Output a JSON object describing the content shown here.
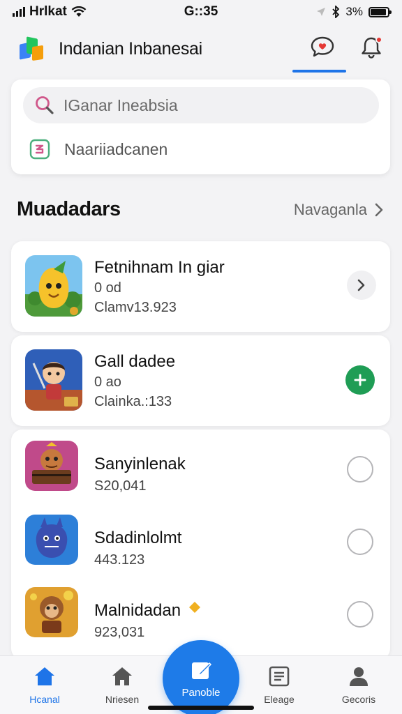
{
  "status_bar": {
    "carrier": "Hrlkat",
    "time": "G::35",
    "battery_text": "3%",
    "battery_level": 0.9
  },
  "header": {
    "app_title": "Indanian Inbanesai",
    "icons": [
      "app-logo-icon",
      "chat-icon",
      "bell-icon"
    ],
    "accent_color": "#1e74e8",
    "notification_color": "#e53935"
  },
  "search": {
    "placeholder": "IGanar Ineabsia",
    "filter_label": "Naariiadcanen"
  },
  "section": {
    "title": "Muadadars",
    "link_label": "Navaganla"
  },
  "games": [
    {
      "title": "Fetnihnam In giar",
      "line1": "0 od",
      "line2": "Clamv13.923",
      "action": "chevron",
      "thumb": "mango-character-icon"
    },
    {
      "title": "Gall dadee",
      "line1": "0 ao",
      "line2": "Clainka.:133",
      "action": "add",
      "thumb": "warrior-boy-icon"
    },
    {
      "title": "Sanyinlenak",
      "line1": "S20,041",
      "action": "select",
      "thumb": "chest-monster-icon"
    },
    {
      "title": "Sdadinlolmt",
      "line1": "443.123",
      "action": "select",
      "thumb": "blue-creature-icon"
    },
    {
      "title": "Malnidadan",
      "line1": "923,031",
      "action": "select",
      "thumb": "monkey-fighter-icon"
    }
  ],
  "bottom_nav": {
    "items": [
      {
        "label": "Hcanal",
        "icon": "home-icon",
        "active": true
      },
      {
        "label": "Nriesen",
        "icon": "home-outline-icon",
        "active": false
      },
      {
        "label": "Panoble",
        "icon": "edit-icon",
        "active": false
      },
      {
        "label": "Eleage",
        "icon": "list-icon",
        "active": false
      },
      {
        "label": "Gecoris",
        "icon": "profile-icon",
        "active": false
      }
    ]
  }
}
